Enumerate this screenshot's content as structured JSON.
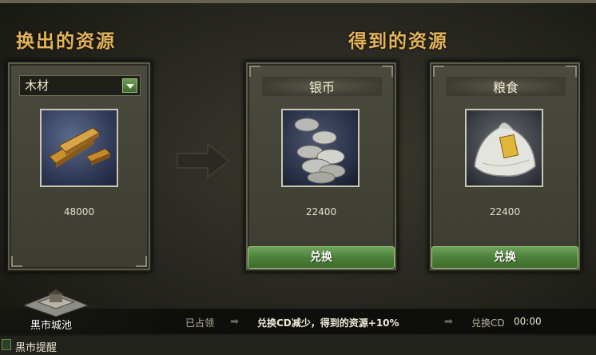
{
  "headings": {
    "give": "换出的资源",
    "get": "得到的资源"
  },
  "give_panel": {
    "selected_resource": "木材",
    "amount": "48000",
    "image_icon": "wood-planks-icon"
  },
  "get_panels": [
    {
      "title": "银币",
      "amount": "22400",
      "button": "兑换",
      "image_icon": "silver-coins-icon"
    },
    {
      "title": "粮食",
      "amount": "22400",
      "button": "兑换",
      "image_icon": "grain-sack-icon"
    }
  ],
  "location_label": "黑市城池",
  "status": {
    "occupied": "已占领",
    "bonus": "兑换CD减少，得到的资源+10%",
    "cd_label": "兑换CD",
    "cd_time": "00:00"
  },
  "reminder_label": "黑市提醒",
  "colors": {
    "heading": "#e3b45a",
    "button_green": "#4c803a"
  }
}
